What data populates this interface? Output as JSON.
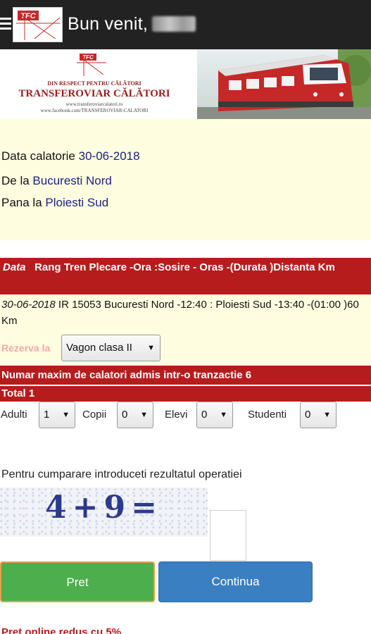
{
  "appbar": {
    "greeting": "Bun venit,",
    "logo_text": "TFC"
  },
  "banner": {
    "logo_text": "TFC",
    "motto": "DIN RESPECT PENTRU CĂLĂTORI",
    "title": "TRANSFEROVIAR CĂLĂTORI",
    "url1": "www.transferoviarcalatori.ro",
    "url2": "www.facebook.com/TRANSFEROVIAR-CALATORI"
  },
  "trip": {
    "date_label": "Data calatorie",
    "date_value": "30-06-2018",
    "from_label": "De la",
    "from_value": "Bucuresti Nord",
    "to_label": "Pana la",
    "to_value": "Ploiesti Sud"
  },
  "table": {
    "header_data": "Data",
    "header_rest": "Rang Tren   Plecare -Ora   :Sosire  - Oras  -(Durata )Distanta Km",
    "row_date": "30-06-2018",
    "row_rest": " IR 15053 Bucuresti Nord -12:40   : Ploiesti Sud -13:40 -(01:00 )60 Km"
  },
  "reservation": {
    "label": "Rezerva la",
    "selected": "Vagon clasa II"
  },
  "limits": {
    "max_text": "Numar maxim de calatori admis intr-o tranzactie 6",
    "total_text": "Total 1"
  },
  "passengers": {
    "adults_label": "Adulti",
    "adults_value": "1",
    "children_label": "Copii",
    "children_value": "0",
    "pupils_label": "Elevi",
    "pupils_value": "0",
    "students_label": "Studenti",
    "students_value": "0"
  },
  "captcha": {
    "label": "Pentru cumparare introduceti rezultatul operatiei",
    "expression": "4+9=",
    "answer": ""
  },
  "buttons": {
    "price": "Pret",
    "continue": "Continua"
  },
  "discount_text": "Pret online redus cu 5%",
  "colors": {
    "appbar": "#222222",
    "info_bg": "#fffde0",
    "red": "#b71c1c",
    "green_button": "#4cae4c",
    "blue_button": "#3a7fc2",
    "value_blue": "#1a237e"
  }
}
